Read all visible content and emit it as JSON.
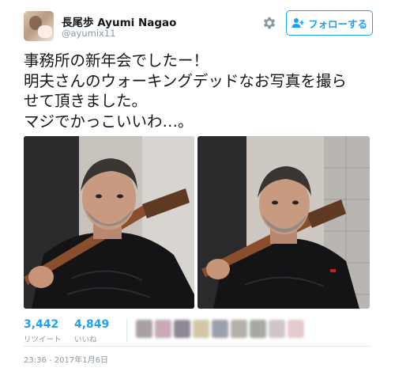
{
  "user": {
    "name": "長尾歩 Ayumi Nagao",
    "handle": "@ayumix11"
  },
  "actions": {
    "follow_label": "フォローする",
    "settings_icon": "gear-icon"
  },
  "tweet": {
    "lines": [
      "事務所の新年会でしたー！",
      "明夫さんのウォーキングデッドなお写真を撮ら",
      "せて頂きました。",
      "マジでかっこいいわ…。"
    ]
  },
  "stats": {
    "retweets": "3,442",
    "retweets_label": "リツイート",
    "likes": "4,849",
    "likes_label": "いいね"
  },
  "timestamp": "23:36 - 2017年1月6日",
  "colors": {
    "accent": "#1da1f2",
    "muted": "#8899a6",
    "text": "#14171a"
  }
}
